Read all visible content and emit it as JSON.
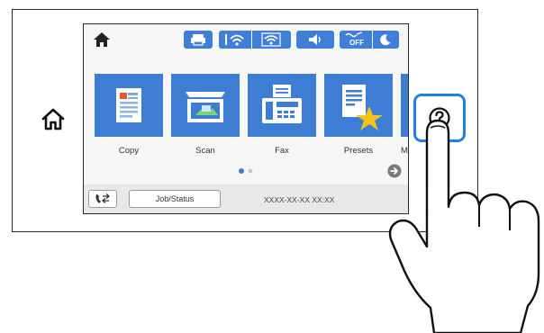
{
  "panel": {
    "apps": [
      {
        "label": "Copy"
      },
      {
        "label": "Scan"
      },
      {
        "label": "Fax"
      },
      {
        "label": "Presets"
      },
      {
        "label": "M"
      }
    ],
    "job_status_label": "Job/Status",
    "datetime": "XXXX-XX-XX XX:XX",
    "status_icons": [
      "printer-icon",
      "wifi-direct-icon",
      "wifi-icon",
      "sound-icon",
      "quiet-mode-icon",
      "sleep-icon"
    ],
    "page_indicator": {
      "pages": 2,
      "current": 1
    }
  },
  "keys": {
    "home": "home-icon",
    "help": "help-icon"
  },
  "colors": {
    "accent": "#3d7dd3",
    "highlight": "#1f7fe8",
    "outline": "#2a2a2a"
  }
}
